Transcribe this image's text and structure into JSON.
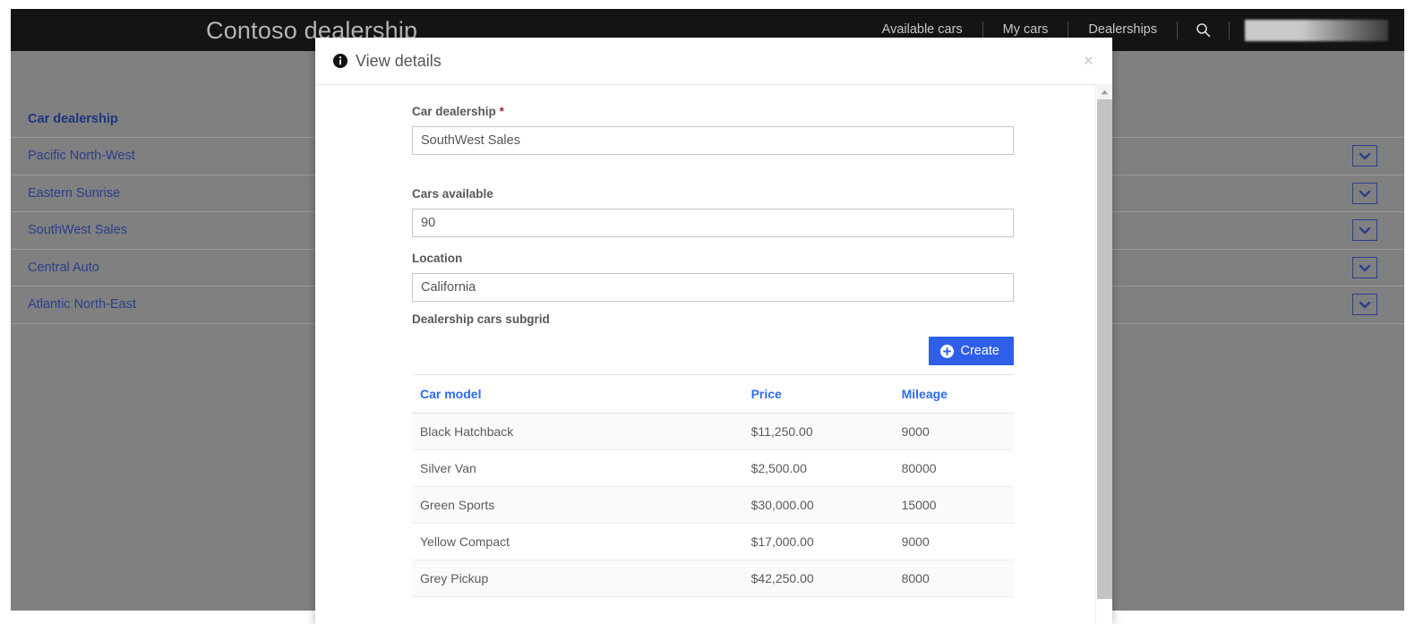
{
  "app": {
    "brand": "Contoso dealership",
    "nav": [
      {
        "label": "Available cars"
      },
      {
        "label": "My cars"
      },
      {
        "label": "Dealerships"
      }
    ],
    "search_icon": "search-icon",
    "user_chip": ""
  },
  "background_grid": {
    "header": "Car dealership",
    "rows": [
      {
        "name": "Pacific North-West"
      },
      {
        "name": "Eastern Sunrise"
      },
      {
        "name": "SouthWest Sales"
      },
      {
        "name": "Central Auto"
      },
      {
        "name": "Atlantic North-East"
      }
    ],
    "row_action_icon": "chevron-down-icon"
  },
  "modal": {
    "title": "View details",
    "title_icon": "info-icon",
    "close_label": "×",
    "fields": {
      "dealership": {
        "label": "Car dealership",
        "required_marker": "*",
        "value": "SouthWest Sales"
      },
      "cars_available": {
        "label": "Cars available",
        "value": "90"
      },
      "location": {
        "label": "Location",
        "value": "California"
      }
    },
    "subgrid": {
      "label": "Dealership cars subgrid",
      "create_label": "Create",
      "create_icon": "plus-circle-icon",
      "columns": [
        {
          "label": "Car model"
        },
        {
          "label": "Price"
        },
        {
          "label": "Mileage"
        }
      ],
      "rows": [
        {
          "model": "Black Hatchback",
          "price": "$11,250.00",
          "mileage": "9000"
        },
        {
          "model": "Silver Van",
          "price": "$2,500.00",
          "mileage": "80000"
        },
        {
          "model": "Green Sports",
          "price": "$30,000.00",
          "mileage": "15000"
        },
        {
          "model": "Yellow Compact",
          "price": "$17,000.00",
          "mileage": "9000"
        },
        {
          "model": "Grey Pickup",
          "price": "$42,250.00",
          "mileage": "8000"
        }
      ]
    }
  },
  "colors": {
    "topbar": "#141414",
    "overlay": "#808080",
    "accent_blue": "#2f5fe8",
    "header_link": "#2f6bf2",
    "grid_link": "#2b3f8c",
    "required": "#a4262c"
  }
}
